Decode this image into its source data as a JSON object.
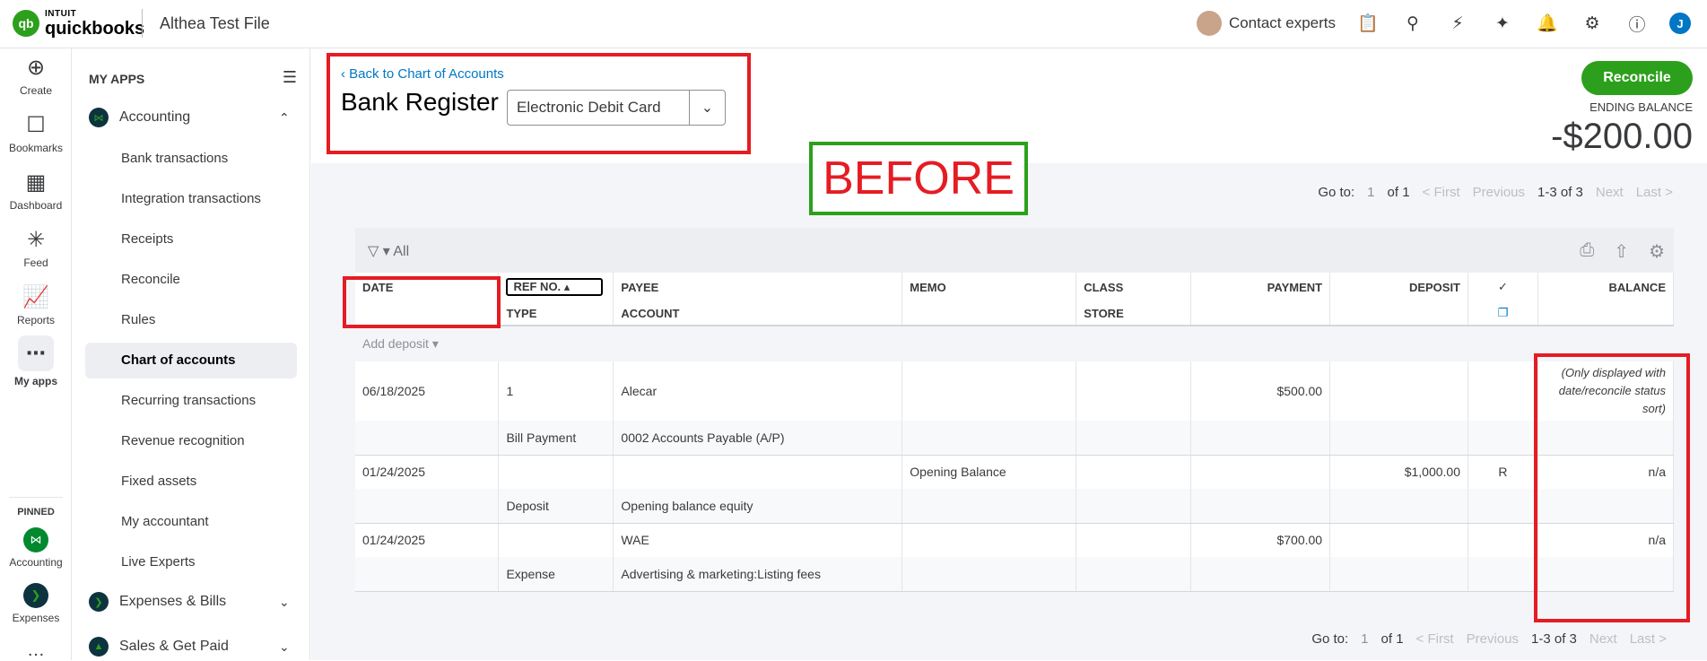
{
  "topbar": {
    "logo_intuit": "INTUIT",
    "logo_quickbooks": "quickbooks",
    "company_name": "Althea Test File",
    "contact_label": "Contact experts",
    "user_initial": "J"
  },
  "rail": {
    "items": [
      {
        "label": "Create",
        "icon": "plus-circle-icon"
      },
      {
        "label": "Bookmarks",
        "icon": "bookmark-icon"
      },
      {
        "label": "Dashboard",
        "icon": "dashboard-icon"
      },
      {
        "label": "Feed",
        "icon": "feed-icon"
      },
      {
        "label": "Reports",
        "icon": "reports-icon"
      },
      {
        "label": "My apps",
        "icon": "apps-grid-icon"
      }
    ],
    "pinned_label": "PINNED",
    "pinned": [
      {
        "label": "Accounting"
      },
      {
        "label": "Expenses"
      }
    ]
  },
  "sidenav": {
    "title": "MY APPS",
    "accounting_label": "Accounting",
    "items": [
      "Bank transactions",
      "Integration transactions",
      "Receipts",
      "Reconcile",
      "Rules",
      "Chart of accounts",
      "Recurring transactions",
      "Revenue recognition",
      "Fixed assets",
      "My accountant",
      "Live Experts"
    ],
    "expenses_label": "Expenses & Bills",
    "sales_label": "Sales & Get Paid"
  },
  "header": {
    "back_link": "Back to Chart of Accounts",
    "title": "Bank Register",
    "account_selected": "Electronic Debit Card",
    "annotation": "BEFORE",
    "reconcile_button": "Reconcile",
    "ending_balance_label": "ENDING BALANCE",
    "ending_balance": "-$200.00"
  },
  "pager": {
    "goto": "Go to:",
    "page": "1",
    "of": "of 1",
    "first": "< First",
    "previous": "Previous",
    "range": "1-3 of 3",
    "next": "Next",
    "last": "Last >"
  },
  "toolbar": {
    "filter_label": "All"
  },
  "table": {
    "headers": {
      "date": "DATE",
      "ref_no": "REF NO.",
      "type": "TYPE",
      "payee": "PAYEE",
      "account": "ACCOUNT",
      "memo": "MEMO",
      "class": "CLASS",
      "store": "STORE",
      "payment": "PAYMENT",
      "deposit": "DEPOSIT",
      "check": "✓",
      "balance": "BALANCE"
    },
    "add_deposit": "Add deposit",
    "rows": [
      {
        "date": "06/18/2025",
        "ref": "1",
        "payee": "Alecar",
        "memo": "",
        "payment": "$500.00",
        "deposit": "",
        "check": "",
        "balance": "(Only displayed with date/reconcile status sort)",
        "type": "Bill Payment",
        "account": "0002 Accounts Payable (A/P)"
      },
      {
        "date": "01/24/2025",
        "ref": "",
        "payee": "",
        "memo": "Opening Balance",
        "payment": "",
        "deposit": "$1,000.00",
        "check": "R",
        "balance": "n/a",
        "type": "Deposit",
        "account": "Opening balance equity"
      },
      {
        "date": "01/24/2025",
        "ref": "",
        "payee": "WAE",
        "memo": "",
        "payment": "$700.00",
        "deposit": "",
        "check": "",
        "balance": "n/a",
        "type": "Expense",
        "account": "Advertising & marketing:Listing fees"
      }
    ]
  }
}
